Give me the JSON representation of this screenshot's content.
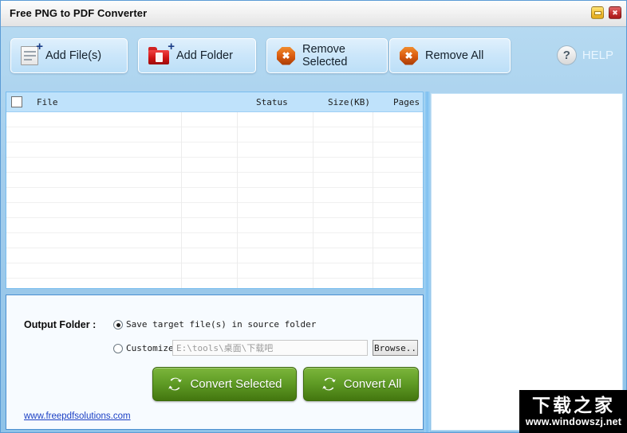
{
  "window": {
    "title": "Free PNG to PDF Converter",
    "minimize_label": "Minimize",
    "close_label": "Close"
  },
  "toolbar": {
    "add_files": {
      "label": "Add File(s)",
      "icon": "file-plus-icon"
    },
    "add_folder": {
      "label": "Add Folder",
      "icon": "folder-plus-icon"
    },
    "remove_selected": {
      "label": "Remove Selected",
      "icon": "remove-x-icon"
    },
    "remove_all": {
      "label": "Remove All",
      "icon": "remove-all-x-icon"
    },
    "help": {
      "label": "HELP",
      "icon": "question-circle-icon"
    }
  },
  "file_list": {
    "select_all_checked": false,
    "columns": [
      "File",
      "Status",
      "Size(KB)",
      "Pages"
    ],
    "rows": [],
    "row_count": 0
  },
  "preview": {
    "content": ""
  },
  "output": {
    "label": "Output Folder :",
    "option_source": {
      "label": "Save target file(s) in source folder",
      "selected": true
    },
    "option_customize": {
      "label": "Customize",
      "selected": false
    },
    "path_value": "E:\\tools\\桌面\\下载吧",
    "browse_label": "Browse.."
  },
  "actions": {
    "convert_selected": "Convert Selected",
    "convert_all": "Convert All",
    "website": "www.freepdfsolutions.com"
  },
  "watermark": {
    "brand_cn": "下载之家",
    "url": "www.windowszj.net"
  },
  "colors": {
    "window_bg_top": "#b9dcf2",
    "window_bg_bottom": "#8fc3e8",
    "toolbar_button": "#cbe6fa",
    "list_header": "#bfe2fb",
    "convert_green": "#5f9b25",
    "link_blue": "#1a3fc4",
    "close_red": "#c53131",
    "minimize_yellow": "#f5c53b",
    "remove_orange": "#da5c10",
    "folder_red": "#cf1414"
  }
}
